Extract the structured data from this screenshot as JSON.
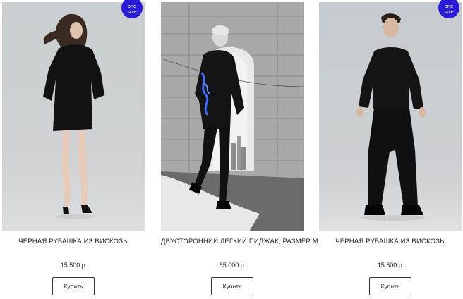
{
  "products": [
    {
      "title": "ЧЕРНАЯ РУБАШКА ИЗ ВИСКОЗЫ",
      "price": "15 500 р.",
      "buy_label": "Купить",
      "badge_line1": "one",
      "badge_line2": "size"
    },
    {
      "title": "ДВУСТОРОННИЙ ЛЕГКИЙ ПИДЖАК, РАЗМЕР М",
      "price": "55 000 р.",
      "buy_label": "Купить"
    },
    {
      "title": "ЧЕРНАЯ РУБАШКА ИЗ ВИСКОЗЫ",
      "price": "15 500 р.",
      "buy_label": "Купить",
      "badge_line1": "one",
      "badge_line2": "size"
    }
  ],
  "colors": {
    "badge": "#2a1bd8",
    "text": "#222222",
    "button_border": "#333333"
  }
}
